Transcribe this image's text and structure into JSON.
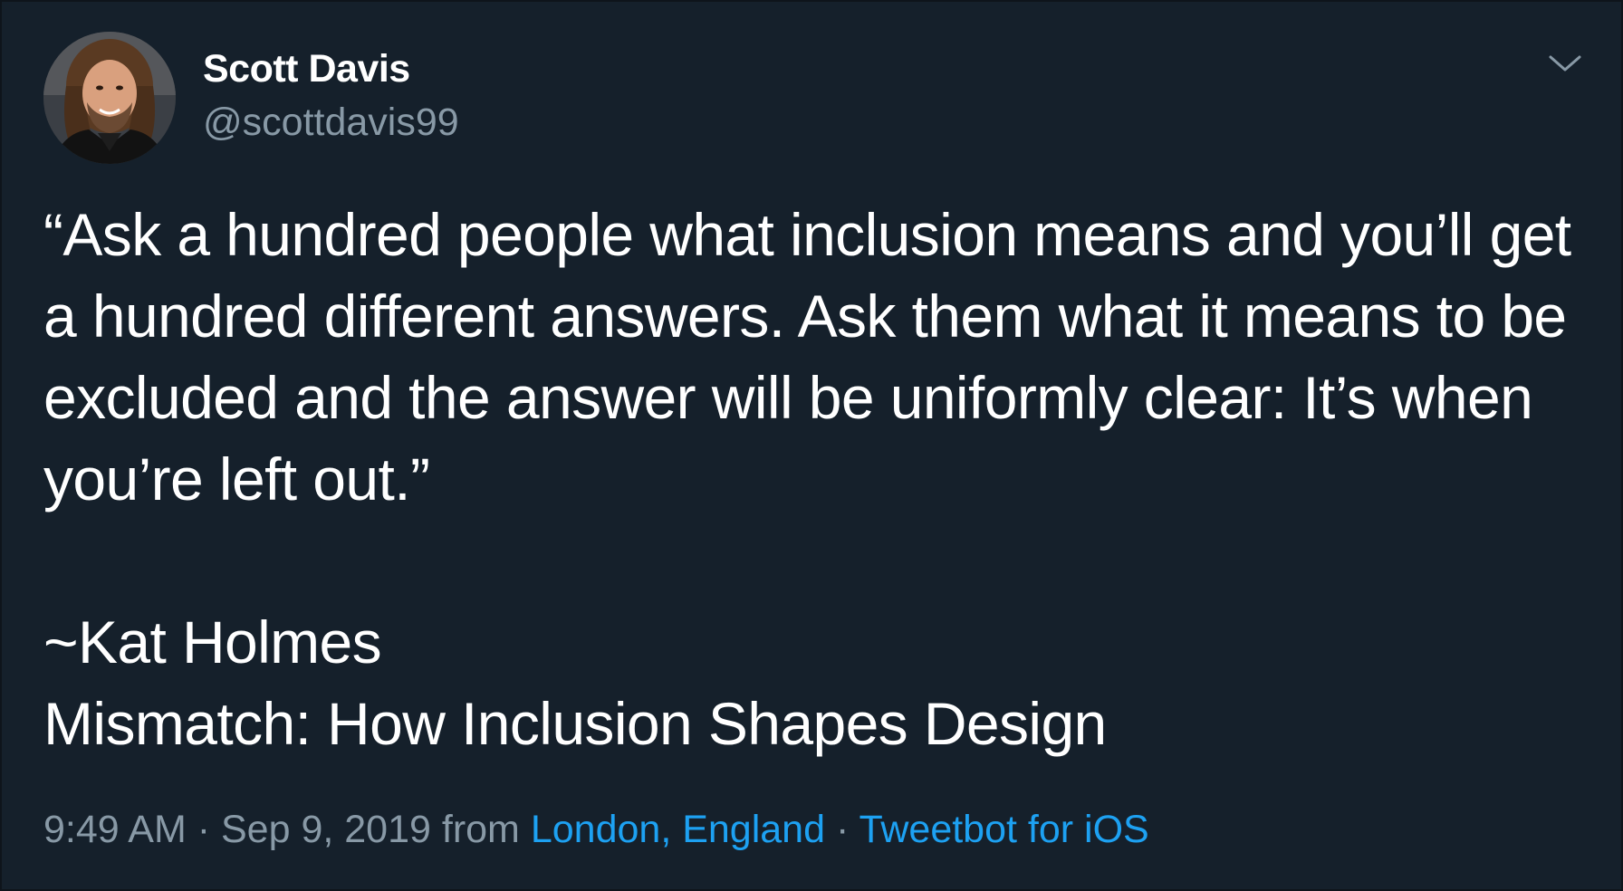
{
  "author": {
    "name": "Scott Davis",
    "handle": "@scottdavis99"
  },
  "tweet": {
    "text": "“Ask a hundred people what inclusion means and you’ll get a hundred different answers. Ask them what it means to be excluded and the answer will be uniformly clear: It’s when you’re left out.”\n\n~Kat Holmes\nMismatch: How Inclusion Shapes Design"
  },
  "meta": {
    "time": "9:49 AM",
    "sep1": " · ",
    "date": "Sep 9, 2019",
    "from_word": " from ",
    "location": "London, England",
    "sep2": " · ",
    "client": "Tweetbot for iOS"
  },
  "colors": {
    "background": "#15202b",
    "text": "#ffffff",
    "secondary_text": "#8899a6",
    "link": "#1da1f2"
  },
  "icons": {
    "menu": "chevron-down-icon",
    "avatar": "profile-photo"
  }
}
